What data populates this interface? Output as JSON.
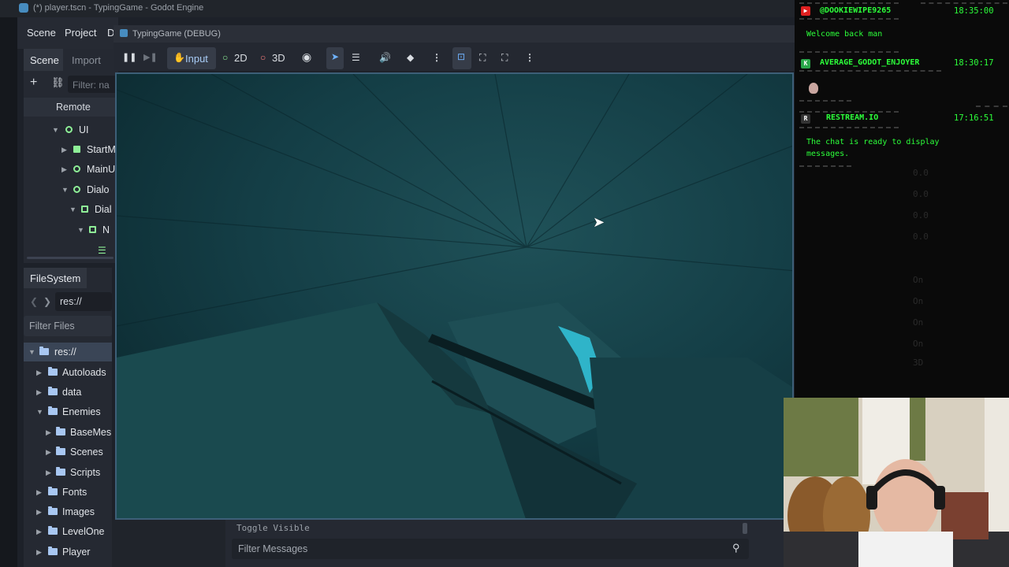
{
  "editor": {
    "window_title": "(*) player.tscn - TypingGame - Godot Engine",
    "menu": [
      "Scene",
      "Project",
      "D"
    ]
  },
  "scene_dock": {
    "tabs": [
      "Scene",
      "Import"
    ],
    "filter_placeholder": "Filter: na",
    "remote_label": "Remote",
    "tree": [
      {
        "label": "UI"
      },
      {
        "label": "StartM"
      },
      {
        "label": "MainU"
      },
      {
        "label": "Dialo"
      },
      {
        "label": "Dial"
      },
      {
        "label": "N"
      }
    ]
  },
  "filesystem": {
    "tab": "FileSystem",
    "path": "res://",
    "filter_placeholder": "Filter Files",
    "items": [
      {
        "label": "res://"
      },
      {
        "label": "Autoloads"
      },
      {
        "label": "data"
      },
      {
        "label": "Enemies"
      },
      {
        "label": "BaseMes"
      },
      {
        "label": "Scenes"
      },
      {
        "label": "Scripts"
      },
      {
        "label": "Fonts"
      },
      {
        "label": "Images"
      },
      {
        "label": "LevelOne"
      },
      {
        "label": "Player"
      }
    ]
  },
  "debug_window": {
    "title": "TypingGame (DEBUG)",
    "toolbar": {
      "input": "Input",
      "mode_2d": "2D",
      "mode_3d": "3D"
    }
  },
  "bottom_panel": {
    "toggle_visible": "Toggle Visible",
    "filter_placeholder": "Filter Messages"
  },
  "chat": {
    "messages": [
      {
        "user": "@DOOKIEWIPE9265",
        "time": "18:35:00",
        "text": "Welcome back man",
        "badge_color": "#e02020"
      },
      {
        "user": "AVERAGE_GODOT_ENJOYER",
        "time": "18:30:17",
        "text": "",
        "badge_color": "#2aa84a"
      },
      {
        "user": "RESTREAM.IO",
        "time": "17:16:51",
        "text": "The chat is ready to display messages.",
        "badge_color": "#333333"
      }
    ]
  },
  "colors": {
    "accent": "#478cbf",
    "node_green": "#8eef97",
    "folder_blue": "#a8c7f2",
    "chat_green": "#2cff3a",
    "viewport_teal": "#133d45"
  }
}
